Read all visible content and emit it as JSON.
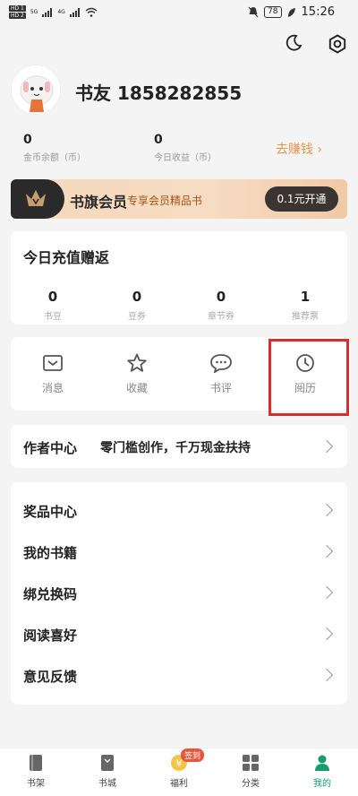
{
  "status_bar": {
    "sim1": "HD 1",
    "sim2": "HD 2",
    "net1": "5G",
    "net2": "4G",
    "battery": "78",
    "time": "15:26"
  },
  "header_icons": [
    "moon-icon",
    "settings-gear-icon"
  ],
  "profile": {
    "username": "书友 1858282855"
  },
  "stats": {
    "coins_value": "0",
    "coins_label": "金币余额（币）",
    "earnings_value": "0",
    "earnings_label": "今日收益（币）",
    "earn_link": "去赚钱 ›"
  },
  "vip": {
    "title": "书旗会员",
    "subtitle": "专享会员精品书",
    "button": "0.1元开通"
  },
  "recharge": {
    "title": "今日充值赠返",
    "items": [
      {
        "value": "0",
        "label": "书豆"
      },
      {
        "value": "0",
        "label": "豆券"
      },
      {
        "value": "0",
        "label": "章节券"
      },
      {
        "value": "1",
        "label": "推荐票"
      }
    ]
  },
  "tools": [
    {
      "label": "消息",
      "icon": "message-icon"
    },
    {
      "label": "收藏",
      "icon": "star-icon"
    },
    {
      "label": "书评",
      "icon": "comment-icon"
    },
    {
      "label": "阅历",
      "icon": "clock-icon"
    }
  ],
  "author": {
    "title": "作者中心",
    "desc": "零门槛创作，千万现金扶持"
  },
  "menu": [
    "奖品中心",
    "我的书籍",
    "绑兑换码",
    "阅读喜好",
    "意见反馈"
  ],
  "tabbar": {
    "sign_badge": "签到",
    "tabs": [
      {
        "label": "书架",
        "icon": "bookshelf-icon"
      },
      {
        "label": "书城",
        "icon": "bookstore-icon"
      },
      {
        "label": "福利",
        "icon": "coin-icon"
      },
      {
        "label": "分类",
        "icon": "category-icon"
      },
      {
        "label": "我的",
        "icon": "user-icon"
      }
    ],
    "active_color": "#14a06e"
  },
  "colors": {
    "accent_orange": "#e8954b",
    "highlight_red": "#d42e2e",
    "active_green": "#14a06e"
  }
}
